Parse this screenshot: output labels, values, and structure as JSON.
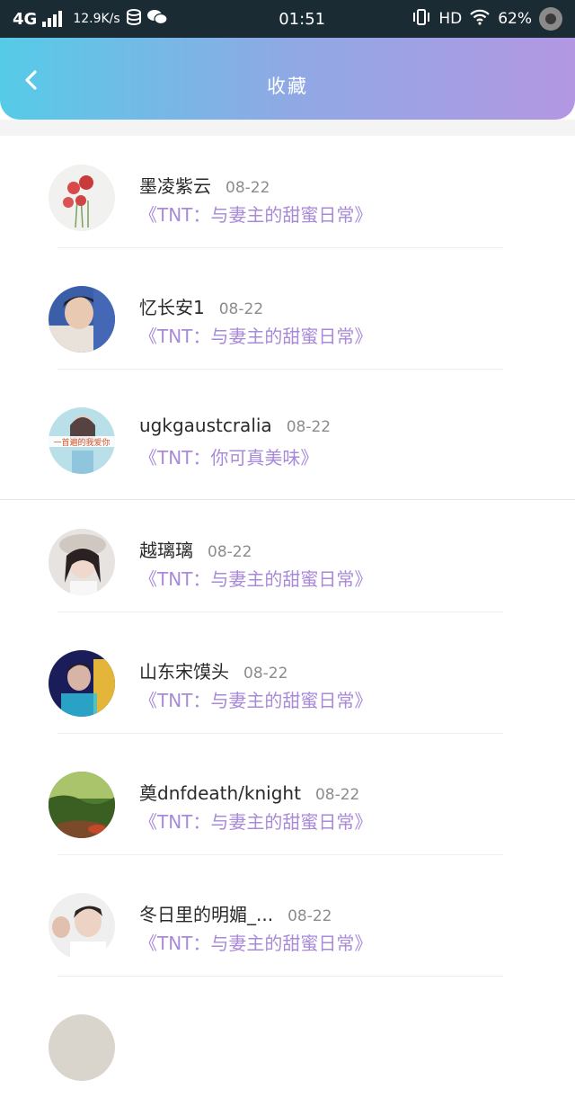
{
  "status_bar": {
    "network": "4G",
    "speed": "12.9K/s",
    "time": "01:51",
    "hd": "HD",
    "battery": "62%",
    "icons": [
      "signal-icon",
      "storage-icon",
      "wechat-icon",
      "vibrate-icon",
      "wifi-icon",
      "battery-icon"
    ]
  },
  "header": {
    "title": "收藏",
    "back_icon": "chevron-left-icon"
  },
  "colors": {
    "header_gradient_start": "#56cbe8",
    "header_gradient_end": "#b397e3",
    "book_title": "#a98ad9",
    "date": "#8c8c8c",
    "status_bar_bg": "#1b2b33"
  },
  "favorites": [
    {
      "username": "墨凌紫云",
      "date": "08-22",
      "title": "《TNT：与妻主的甜蜜日常》"
    },
    {
      "username": "忆长安1",
      "date": "08-22",
      "title": "《TNT：与妻主的甜蜜日常》"
    },
    {
      "username": "ugkgaustcralia",
      "date": "08-22",
      "title": "《TNT：你可真美味》"
    },
    {
      "username": "越璃璃",
      "date": "08-22",
      "title": "《TNT：与妻主的甜蜜日常》"
    },
    {
      "username": "山东宋馍头",
      "date": "08-22",
      "title": "《TNT：与妻主的甜蜜日常》"
    },
    {
      "username": "奠dnfdeath/knight",
      "date": "08-22",
      "title": "《TNT：与妻主的甜蜜日常》"
    },
    {
      "username": "冬日里的明媚_...",
      "date": "08-22",
      "title": "《TNT：与妻主的甜蜜日常》"
    }
  ]
}
